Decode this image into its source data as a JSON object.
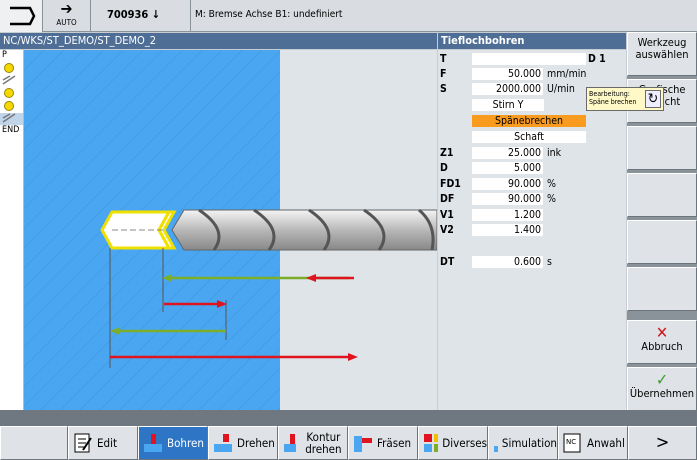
{
  "top": {
    "mode": "AUTO",
    "program": "700936",
    "program_marker": "↓",
    "message": "M: Bremse Achse B1: undefiniert"
  },
  "path": "NC/WKS/ST_DEMO/ST_DEMO_2",
  "form_title": "Tieflochbohren",
  "left_items": [
    "P",
    "",
    "",
    "",
    "",
    "",
    "",
    "",
    "END"
  ],
  "params": [
    {
      "label": "T",
      "value": "",
      "unit": "",
      "extra": "D 1"
    },
    {
      "label": "F",
      "value": "50.000",
      "unit": "mm/min"
    },
    {
      "label": "S",
      "value": "2000.000",
      "unit": "U/min"
    },
    {
      "label": "",
      "value": "Stirn Y",
      "unit": ""
    },
    {
      "label": "",
      "value": "Spänebrechen",
      "unit": "",
      "highlight": true
    },
    {
      "label": "",
      "value": "Schaft",
      "unit": ""
    },
    {
      "label": "Z1",
      "value": "25.000",
      "unit": "ink"
    },
    {
      "label": "D",
      "value": "5.000",
      "unit": ""
    },
    {
      "label": "FD1",
      "value": "90.000",
      "unit": "%"
    },
    {
      "label": "DF",
      "value": "90.000",
      "unit": "%"
    },
    {
      "label": "V1",
      "value": "1.200",
      "unit": ""
    },
    {
      "label": "V2",
      "value": "1.400",
      "unit": ""
    },
    {
      "label": "DT",
      "value": "0.600",
      "unit": "s"
    }
  ],
  "tooltip": {
    "line1": "Bearbeitung:",
    "line2": "Späne brechen"
  },
  "right_softkeys": [
    {
      "label": "Werkzeug auswählen",
      "icon": ""
    },
    {
      "label": "Grafische Ansicht",
      "icon": ""
    },
    {
      "label": "",
      "icon": ""
    },
    {
      "label": "",
      "icon": ""
    },
    {
      "label": "",
      "icon": ""
    },
    {
      "label": "",
      "icon": ""
    },
    {
      "label": "Abbruch",
      "icon": "✕"
    },
    {
      "label": "Übernehmen",
      "icon": "✓"
    }
  ],
  "bottom_softkeys": [
    {
      "label": "Edit",
      "icon": "edit-icon"
    },
    {
      "label": "Bohren",
      "icon": "drill-icon",
      "active": true
    },
    {
      "label": "Drehen",
      "icon": "turn-icon"
    },
    {
      "label": "Kontur drehen",
      "icon": "contour-turn-icon"
    },
    {
      "label": "Fräsen",
      "icon": "mill-icon"
    },
    {
      "label": "Diverses",
      "icon": "misc-icon"
    },
    {
      "label": "Simulation",
      "icon": "simulation-icon"
    },
    {
      "label": "Anwahl",
      "icon": "nc-select-icon"
    },
    {
      "label": ">",
      "icon": ""
    }
  ],
  "colors": {
    "header_blue": "#4e6e96",
    "highlight_orange": "#f89b1e",
    "workpiece_blue": "#4aa6f0",
    "arrow_red": "#e0141e",
    "arrow_green": "#7cae2a",
    "outline_yellow": "#f0e000"
  }
}
